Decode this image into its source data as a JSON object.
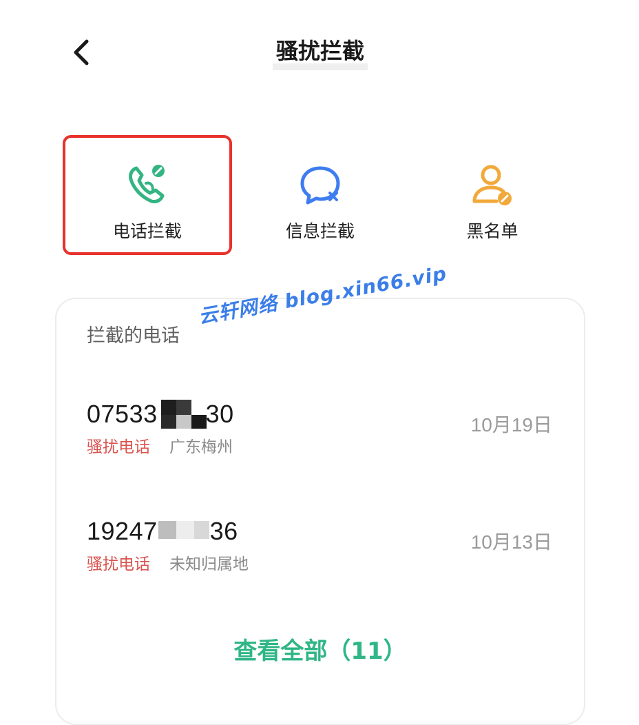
{
  "header": {
    "title": "骚扰拦截",
    "back_icon": "chevron-left-icon"
  },
  "features": [
    {
      "label": "电话拦截",
      "icon": "phone-block-icon",
      "color": "#33b583",
      "selected": true
    },
    {
      "label": "信息拦截",
      "icon": "message-block-icon",
      "color": "#3e7df0",
      "selected": false
    },
    {
      "label": "黑名单",
      "icon": "person-block-icon",
      "color": "#f2a93b",
      "selected": false
    }
  ],
  "watermark": "云轩网络  blog.xin66.vip",
  "blocked": {
    "title": "拦截的电话",
    "rows": [
      {
        "number": "07533",
        "number_tail": "30",
        "tag": "骚扰电话",
        "location": "广东梅州",
        "date": "10月19日"
      },
      {
        "number": "19247",
        "number_tail": "36",
        "tag": "骚扰电话",
        "location": "未知归属地",
        "date": "10月13日"
      }
    ],
    "view_all": "查看全部（11）"
  },
  "colors": {
    "accent_green": "#2fb686",
    "selected_border": "#e8312b",
    "harass_red": "#d9534f"
  }
}
